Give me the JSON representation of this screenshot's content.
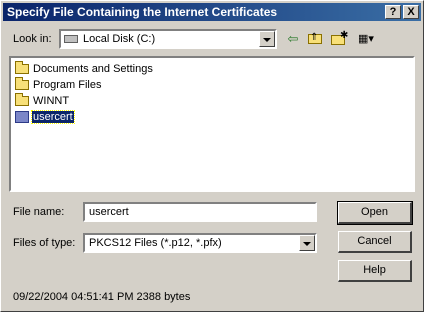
{
  "window": {
    "title": "Specify File Containing the Internet Certificates",
    "help_glyph": "?",
    "close_glyph": "X"
  },
  "look_in": {
    "label": "Look in:",
    "value": "Local Disk (C:)",
    "drive_icon": "hard-drive-icon"
  },
  "toolbar": {
    "back_glyph": "⇦",
    "up_glyph": "⇑",
    "new_folder_glyph": "✱",
    "view_glyph": "▦▾"
  },
  "files": [
    {
      "name": "Documents and Settings",
      "type": "folder"
    },
    {
      "name": "Program Files",
      "type": "folder"
    },
    {
      "name": "WINNT",
      "type": "folder"
    },
    {
      "name": "usercert",
      "type": "certificate",
      "selected": true
    }
  ],
  "file_name": {
    "label": "File name:",
    "value": "usercert"
  },
  "file_type": {
    "label": "Files of type:",
    "value": "PKCS12 Files (*.p12, *.pfx)"
  },
  "buttons": {
    "open": "Open",
    "cancel": "Cancel",
    "help": "Help"
  },
  "status": {
    "text": "09/22/2004 04:51:41 PM 2388 bytes"
  },
  "colors": {
    "title_bar": "#0a246a",
    "selection": "#0a246a",
    "face": "#d4d0c8"
  }
}
